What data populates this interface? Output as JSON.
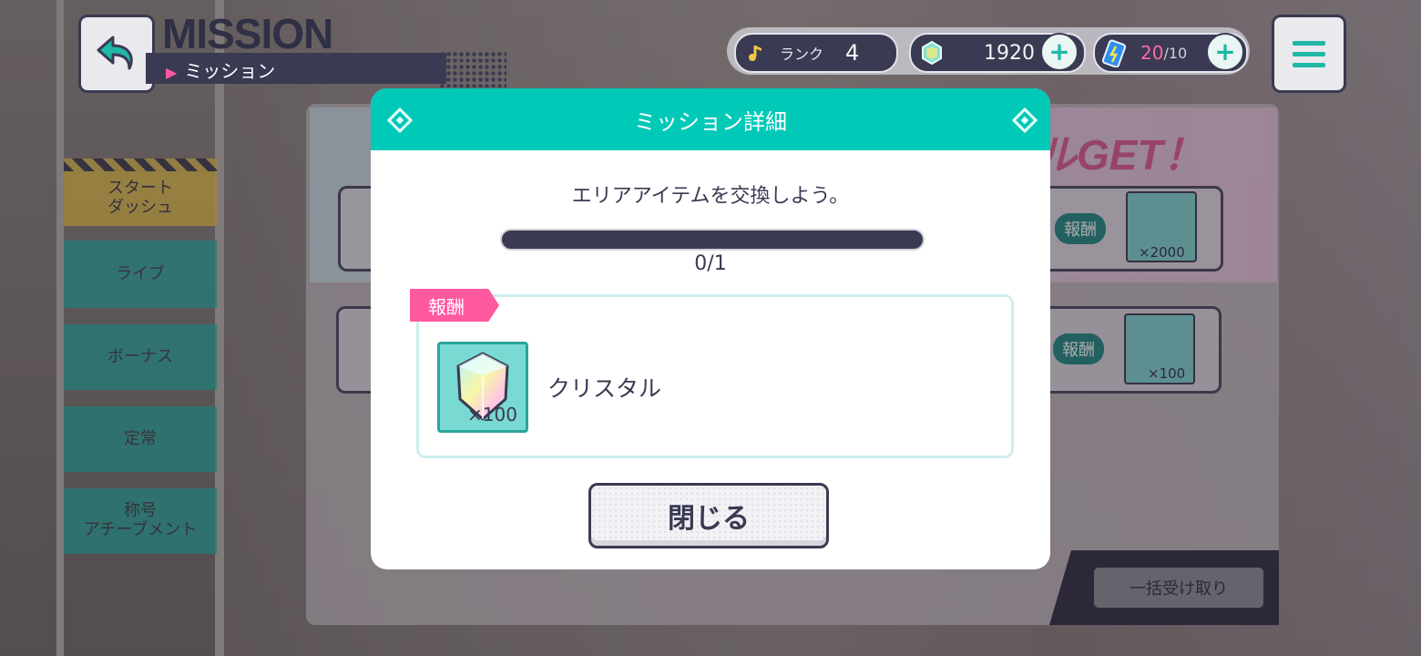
{
  "header": {
    "title_en": "MISSION",
    "title_jp": "ミッション"
  },
  "status": {
    "rank_label": "ランク",
    "rank_value": "4",
    "crystals": "1920",
    "stamina_current": "20",
    "stamina_max": "/10",
    "plus_label": "+"
  },
  "tabs": [
    {
      "label": "スタート\nダッシュ",
      "active": true
    },
    {
      "label": "ライブ"
    },
    {
      "label": "ボーナス"
    },
    {
      "label": "定常"
    },
    {
      "label": "称号\nアチーブメント"
    }
  ],
  "background": {
    "banner_text": "ルGET！",
    "reward_label": "報酬",
    "card1_qty": "×2000",
    "card2_qty": "×100",
    "bulk_button": "一括受け取り"
  },
  "modal": {
    "title": "ミッション詳細",
    "mission_text": "エリアアイテムを交換しよう。",
    "progress_text": "0/1",
    "progress_fraction": 0,
    "reward_tag": "報酬",
    "reward_item_name": "クリスタル",
    "reward_item_qty": "×100",
    "close_button": "閉じる"
  },
  "colors": {
    "teal": "#00c9b7",
    "navy": "#3a3a52",
    "pink": "#ff5aa0",
    "yellow": "#e8c64a"
  }
}
